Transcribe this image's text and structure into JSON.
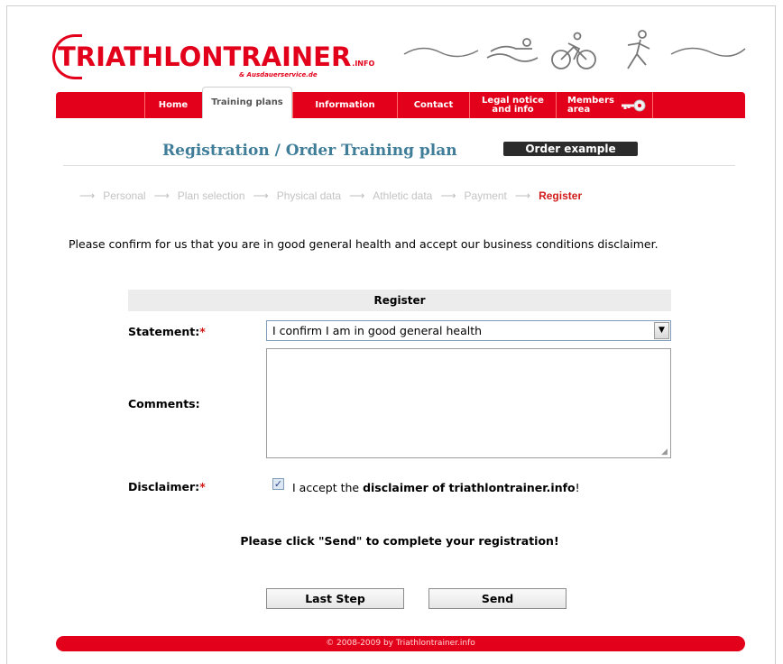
{
  "header": {
    "logo_main": "TRIATHLONTRAINER",
    "logo_suffix": ".INFO",
    "logo_sub": "& Ausdauerservice.de"
  },
  "nav": {
    "tabs": [
      {
        "label": "Home"
      },
      {
        "label": "Training plans",
        "active": true
      },
      {
        "label": "Information"
      },
      {
        "label": "Contact"
      },
      {
        "label": "Legal notice\nand info"
      },
      {
        "label": "Members\narea"
      }
    ]
  },
  "title": {
    "text": "Registration / Order Training plan",
    "order_example": "Order example"
  },
  "steps": {
    "items": [
      "Personal",
      "Plan selection",
      "Physical data",
      "Athletic data",
      "Payment",
      "Register"
    ],
    "current": "Register"
  },
  "intro": "Please confirm for us that you are in good general health and accept our business conditions disclaimer.",
  "form": {
    "heading": "Register",
    "statement_label": "Statement:",
    "required_mark": "*",
    "statement_value": "I confirm I am in good general health",
    "comments_label": "Comments:",
    "comments_value": "",
    "disclaimer_label": "Disclaimer:",
    "disclaimer_checked": true,
    "disclaimer_prefix": "I accept the ",
    "disclaimer_link": "disclaimer of triathlontrainer.info",
    "disclaimer_suffix": "!",
    "note": "Please click \"Send\" to complete your registration!",
    "last_step_label": "Last Step",
    "send_label": "Send"
  },
  "footer": {
    "text": "© 2008-2009 by Triathlontrainer.info"
  },
  "colors": {
    "brand_red": "#e2001a",
    "title_blue": "#3f7d99",
    "step_current": "#d11a1a"
  }
}
